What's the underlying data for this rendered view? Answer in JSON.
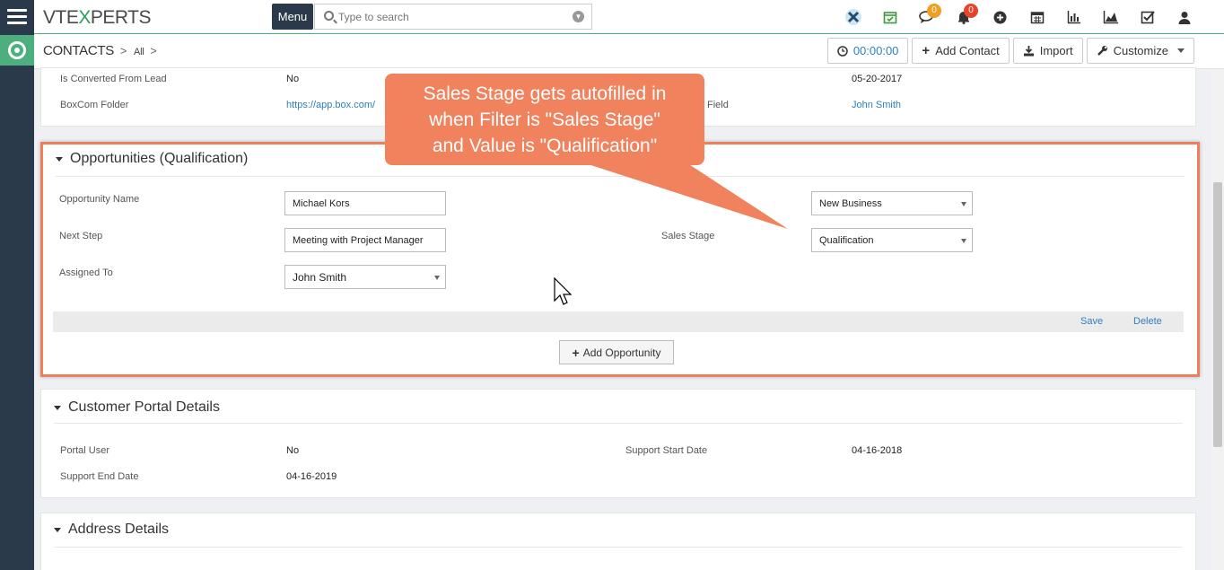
{
  "app": {
    "logo_a": "VTE",
    "logo_b": "X",
    "logo_c": "PERTS",
    "menu_label": "Menu"
  },
  "search": {
    "placeholder": "Type to search"
  },
  "topbar": {
    "chat_badge": "0",
    "notif_badge": "0"
  },
  "breadcrumb": {
    "module": "CONTACTS",
    "sep": ">",
    "view": "All"
  },
  "actions": {
    "timer": "00:00:00",
    "add_contact": "Add Contact",
    "import": "Import",
    "customize": "Customize"
  },
  "details": {
    "converted_label": "Is Converted From Lead",
    "converted_value": "No",
    "boxcom_label": "BoxCom Folder",
    "boxcom_value": "https://app.box.com/",
    "date_value": "05-20-2017",
    "partial_field_label": "Field",
    "user_value": "John Smith"
  },
  "opportunity": {
    "title": "Opportunities (Qualification)",
    "name_label": "Opportunity Name",
    "name_value": "Michael Kors",
    "next_step_label": "Next Step",
    "next_step_value": "Meeting with Project Manager",
    "assigned_label": "Assigned To",
    "assigned_value": "John Smith",
    "type_value": "New Business",
    "stage_label": "Sales Stage",
    "stage_value": "Qualification",
    "save": "Save",
    "delete": "Delete",
    "add": "Add Opportunity"
  },
  "callout": {
    "line1": "Sales Stage gets autofilled in",
    "line2": "when Filter is \"Sales Stage\"",
    "line3": "and Value is \"Qualification\""
  },
  "portal": {
    "title": "Customer Portal Details",
    "portal_user_label": "Portal User",
    "portal_user_value": "No",
    "start_label": "Support Start Date",
    "start_value": "04-16-2018",
    "end_label": "Support End Date",
    "end_value": "04-16-2019"
  },
  "address": {
    "title": "Address Details"
  },
  "colors": {
    "accent": "#4caf7d",
    "callout": "#f0825d",
    "highlight_border": "#ef7e5a",
    "link": "#2d7fc1",
    "rail": "#2b3a4b"
  }
}
